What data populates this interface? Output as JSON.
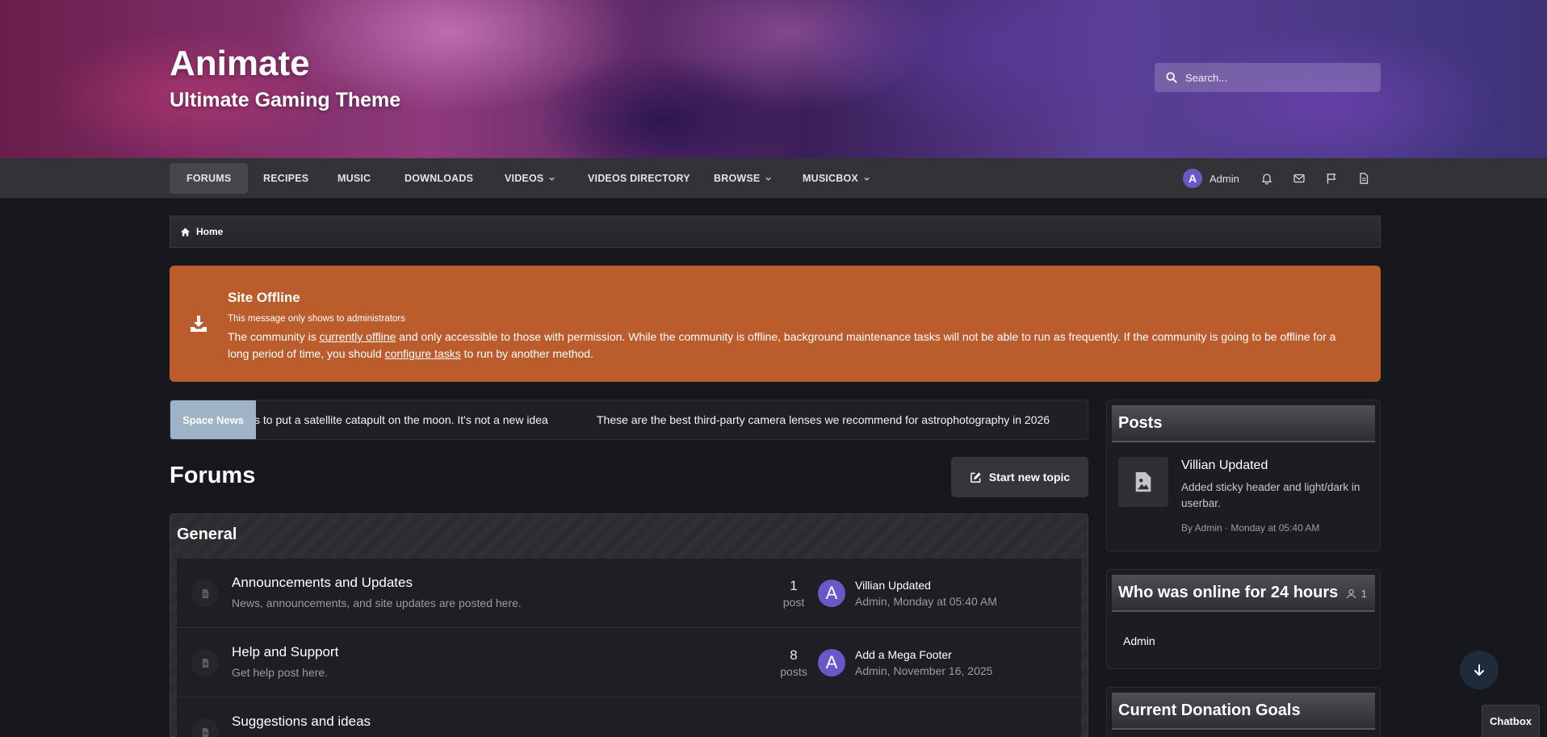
{
  "site": {
    "title": "Animate",
    "subtitle": "Ultimate Gaming Theme"
  },
  "search": {
    "placeholder": "Search..."
  },
  "nav": {
    "items": [
      {
        "label": "FORUMS",
        "active": true,
        "dropdown": false
      },
      {
        "label": "RECIPES",
        "active": false,
        "dropdown": false
      },
      {
        "label": "MUSIC",
        "active": false,
        "dropdown": false
      },
      {
        "label": "DOWNLOADS",
        "active": false,
        "dropdown": false
      },
      {
        "label": "VIDEOS",
        "active": false,
        "dropdown": true
      },
      {
        "label": "VIDEOS DIRECTORY",
        "active": false,
        "dropdown": false
      },
      {
        "label": "BROWSE",
        "active": false,
        "dropdown": true
      },
      {
        "label": "MUSICBOX",
        "active": false,
        "dropdown": true
      }
    ],
    "user": {
      "initial": "A",
      "name": "Admin"
    },
    "icons": [
      "bell-icon",
      "mail-icon",
      "flag-icon",
      "document-icon"
    ]
  },
  "breadcrumb": {
    "home": "Home"
  },
  "notice": {
    "title": "Site Offline",
    "small": "This message only shows to administrators",
    "text_1": "The community is ",
    "link_1": "currently offline",
    "text_2": " and only accessible to those with permission. While the community is offline, background maintenance tasks will not be able to run as frequently. If the community is going to be offline for a long period of time, you should ",
    "link_2": "configure tasks",
    "text_3": " to run by another method.",
    "color": "#bb5c2d"
  },
  "ticker": {
    "label": "Space News",
    "items": [
      "s to put a satellite catapult on the moon. It's not a new idea",
      "These are the best third-party camera lenses we recommend for astrophotography in 2026"
    ]
  },
  "forums": {
    "title": "Forums",
    "new_topic": "Start new topic",
    "category": "General",
    "rows": [
      {
        "title": "Announcements and Updates",
        "desc": "News, announcements, and site updates are posted here.",
        "count": "1",
        "unit": "post",
        "last_initial": "A",
        "last_title": "Villian Updated",
        "last_meta": "Admin, Monday at 05:40 AM"
      },
      {
        "title": "Help and Support",
        "desc": "Get help post here.",
        "count": "8",
        "unit": "posts",
        "last_initial": "A",
        "last_title": "Add a Mega Footer",
        "last_meta": "Admin, November 16, 2025"
      },
      {
        "title": "Suggestions and ideas",
        "desc": "",
        "count": "",
        "unit": "",
        "last_initial": "",
        "last_title": "",
        "last_meta": ""
      }
    ]
  },
  "sidebar": {
    "posts": {
      "title": "Posts",
      "item_title": "Villian Updated",
      "item_text": "Added sticky header and light/dark in userbar.",
      "item_meta": "By Admin · Monday at 05:40 AM"
    },
    "online": {
      "title": "Who was online for 24 hours",
      "count": "1",
      "names": [
        "Admin"
      ]
    },
    "donation": {
      "title": "Current Donation Goals"
    }
  },
  "chatbox": {
    "label": "Chatbox"
  },
  "colors": {
    "accent": "#6a58c8",
    "notice": "#bb5c2d",
    "ticker_label": "#9fb3c6"
  }
}
